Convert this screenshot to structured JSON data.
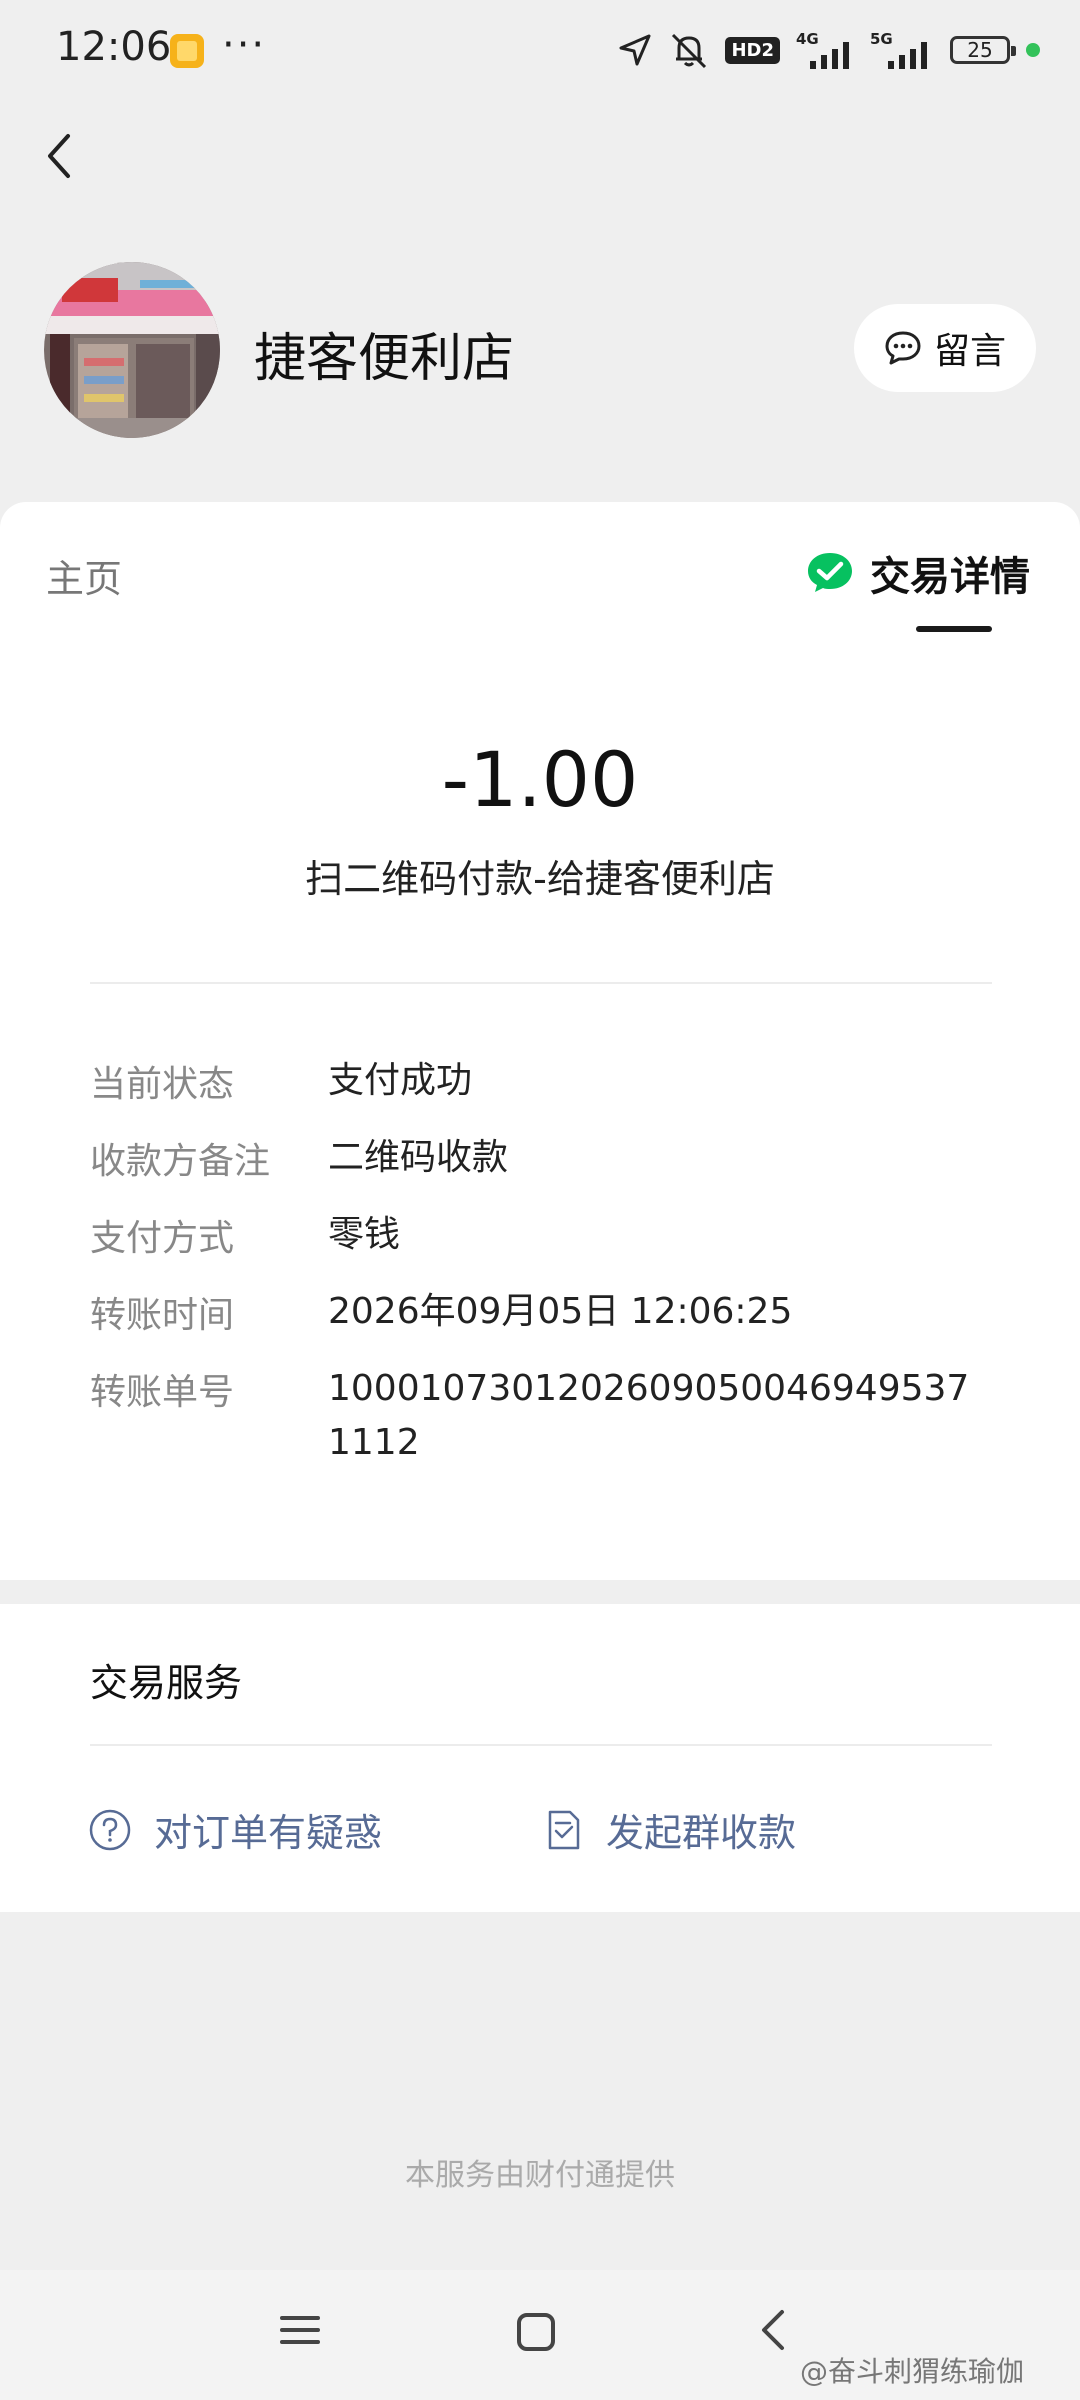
{
  "status_bar": {
    "time": "12:06",
    "dots": "···",
    "hd_badge": "HD2",
    "net1": "4G",
    "net2": "5G",
    "battery": "25"
  },
  "header": {
    "merchant_name": "捷客便利店",
    "message_label": "留言"
  },
  "tabs": {
    "home": "主页",
    "detail": "交易详情"
  },
  "transaction": {
    "amount": "-1.00",
    "description": "扫二维码付款-给捷客便利店",
    "rows": [
      {
        "label": "当前状态",
        "value": "支付成功"
      },
      {
        "label": "收款方备注",
        "value": "二维码收款"
      },
      {
        "label": "支付方式",
        "value": "零钱"
      },
      {
        "label": "转账时间",
        "value": "2026年09月05日 12:06:25"
      },
      {
        "label": "转账单号",
        "value": "10001073012026090500469495371112"
      }
    ]
  },
  "services": {
    "title": "交易服务",
    "question_label": "对订单有疑惑",
    "group_label": "发起群收款"
  },
  "footer": "本服务由财付通提供",
  "watermark": "@奋斗刺猬练瑜伽",
  "colors": {
    "wechat_green": "#07c160",
    "link_blue": "#576b95",
    "background": "#efefef"
  }
}
